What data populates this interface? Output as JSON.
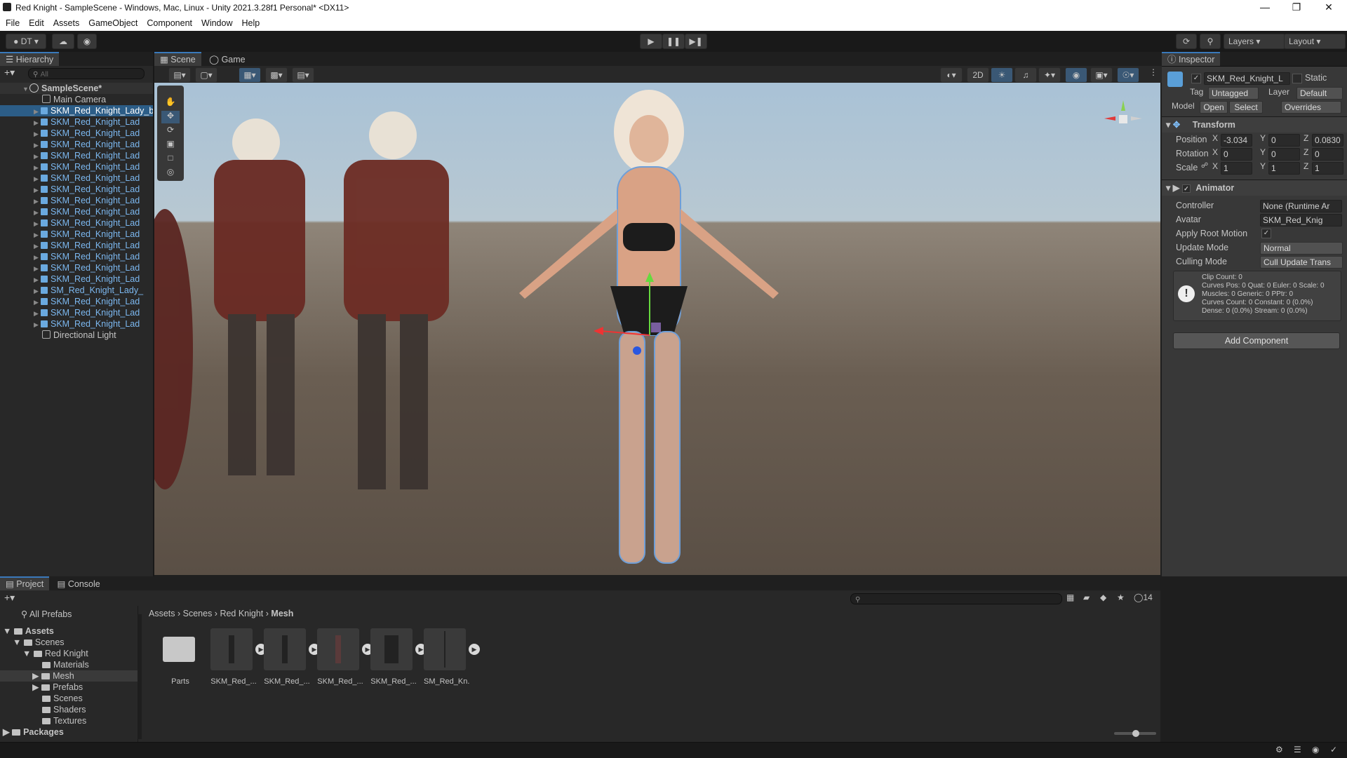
{
  "window": {
    "title": "Red Knight - SampleScene - Windows, Mac, Linux - Unity 2021.3.28f1 Personal* <DX11>"
  },
  "menu": [
    "File",
    "Edit",
    "Assets",
    "GameObject",
    "Component",
    "Window",
    "Help"
  ],
  "toolbar": {
    "account": "DT",
    "layers": "Layers",
    "layout": "Layout"
  },
  "hierarchy": {
    "tab": "Hierarchy",
    "search_placeholder": "All",
    "scene": "SampleScene*",
    "items": [
      {
        "label": "Main Camera",
        "selected": false
      },
      {
        "label": "SKM_Red_Knight_Lady_b",
        "selected": true
      },
      {
        "label": "SKM_Red_Knight_Lad",
        "selected": false
      },
      {
        "label": "SKM_Red_Knight_Lad",
        "selected": false
      },
      {
        "label": "SKM_Red_Knight_Lad",
        "selected": false
      },
      {
        "label": "SKM_Red_Knight_Lad",
        "selected": false
      },
      {
        "label": "SKM_Red_Knight_Lad",
        "selected": false
      },
      {
        "label": "SKM_Red_Knight_Lad",
        "selected": false
      },
      {
        "label": "SKM_Red_Knight_Lad",
        "selected": false
      },
      {
        "label": "SKM_Red_Knight_Lad",
        "selected": false
      },
      {
        "label": "SKM_Red_Knight_Lad",
        "selected": false
      },
      {
        "label": "SKM_Red_Knight_Lad",
        "selected": false
      },
      {
        "label": "SKM_Red_Knight_Lad",
        "selected": false
      },
      {
        "label": "SKM_Red_Knight_Lad",
        "selected": false
      },
      {
        "label": "SKM_Red_Knight_Lad",
        "selected": false
      },
      {
        "label": "SKM_Red_Knight_Lad",
        "selected": false
      },
      {
        "label": "SKM_Red_Knight_Lad",
        "selected": false
      },
      {
        "label": "SM_Red_Knight_Lady_",
        "selected": false
      },
      {
        "label": "SKM_Red_Knight_Lad",
        "selected": false
      },
      {
        "label": "SKM_Red_Knight_Lad",
        "selected": false
      },
      {
        "label": "SKM_Red_Knight_Lad",
        "selected": false
      },
      {
        "label": "Directional Light",
        "selected": false
      }
    ]
  },
  "scene_view": {
    "tabs": [
      "Scene",
      "Game"
    ],
    "mode_2d": "2D"
  },
  "inspector": {
    "tab": "Inspector",
    "object_name": "SKM_Red_Knight_L",
    "static": "Static",
    "tag_label": "Tag",
    "tag": "Untagged",
    "layer_label": "Layer",
    "layer": "Default",
    "model_label": "Model",
    "open": "Open",
    "select": "Select",
    "overrides": "Overrides",
    "transform": {
      "title": "Transform",
      "position_label": "Position",
      "position": {
        "x": "-3.034",
        "y": "0",
        "z": "0.0830"
      },
      "rotation_label": "Rotation",
      "rotation": {
        "x": "0",
        "y": "0",
        "z": "0"
      },
      "scale_label": "Scale",
      "scale": {
        "x": "1",
        "y": "1",
        "z": "1"
      }
    },
    "animator": {
      "title": "Animator",
      "controller_label": "Controller",
      "controller": "None (Runtime Ar",
      "avatar_label": "Avatar",
      "avatar": "SKM_Red_Knig",
      "root_motion_label": "Apply Root Motion",
      "update_mode_label": "Update Mode",
      "update_mode": "Normal",
      "culling_mode_label": "Culling Mode",
      "culling_mode": "Cull Update Trans",
      "info": [
        "Clip Count: 0",
        "Curves Pos: 0 Quat: 0 Euler: 0 Scale: 0",
        "Muscles: 0 Generic: 0 PPtr: 0",
        "Curves Count: 0 Constant: 0 (0.0%)",
        "Dense: 0 (0.0%) Stream: 0 (0.0%)"
      ]
    },
    "add_component": "Add Component"
  },
  "project": {
    "tabs": [
      "Project",
      "Console"
    ],
    "hidden_count": "14",
    "breadcrumb": [
      "Assets",
      "Scenes",
      "Red Knight",
      "Mesh"
    ],
    "tree": {
      "all_prefabs": "All Prefabs",
      "assets": "Assets",
      "scenes": "Scenes",
      "red_knight": "Red Knight",
      "children": [
        "Materials",
        "Mesh",
        "Prefabs",
        "Scenes",
        "Shaders",
        "Textures"
      ],
      "packages": "Packages"
    },
    "assets": [
      "Parts",
      "SKM_Red_...",
      "SKM_Red_...",
      "SKM_Red_...",
      "SKM_Red_...",
      "SM_Red_Kn..."
    ]
  },
  "colors": {
    "accent": "#3a79bb",
    "selection": "#2c5d87"
  }
}
